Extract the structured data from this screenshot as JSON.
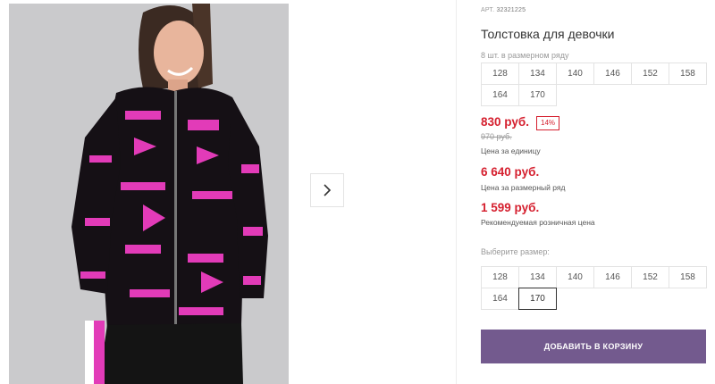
{
  "product": {
    "art_label": "АРТ.",
    "art_number": "32321225",
    "title": "Толстовка для девочки",
    "count_in_row": "8 шт. в размерном ряду",
    "sizes_row": [
      "128",
      "134",
      "140",
      "146",
      "152",
      "158",
      "164",
      "170"
    ],
    "price_unit": "830 руб.",
    "discount": "14%",
    "old_price": "970 руб.",
    "price_unit_caption": "Цена за единицу",
    "price_row": "6 640 руб.",
    "price_row_caption": "Цена за размерный ряд",
    "price_retail": "1 599 руб.",
    "price_retail_caption": "Рекомендуемая розничная цена",
    "choose_size_label": "Выберите размер:",
    "size_options": [
      "128",
      "134",
      "140",
      "146",
      "152",
      "158",
      "164",
      "170"
    ],
    "selected_size": "170",
    "add_to_cart": "ДОБАВИТЬ В КОРЗИНУ"
  },
  "icons": {
    "next": "chevron-right-icon"
  },
  "colors": {
    "accent": "#735a8e",
    "price": "#d5202f",
    "print": "#e23bb8"
  }
}
